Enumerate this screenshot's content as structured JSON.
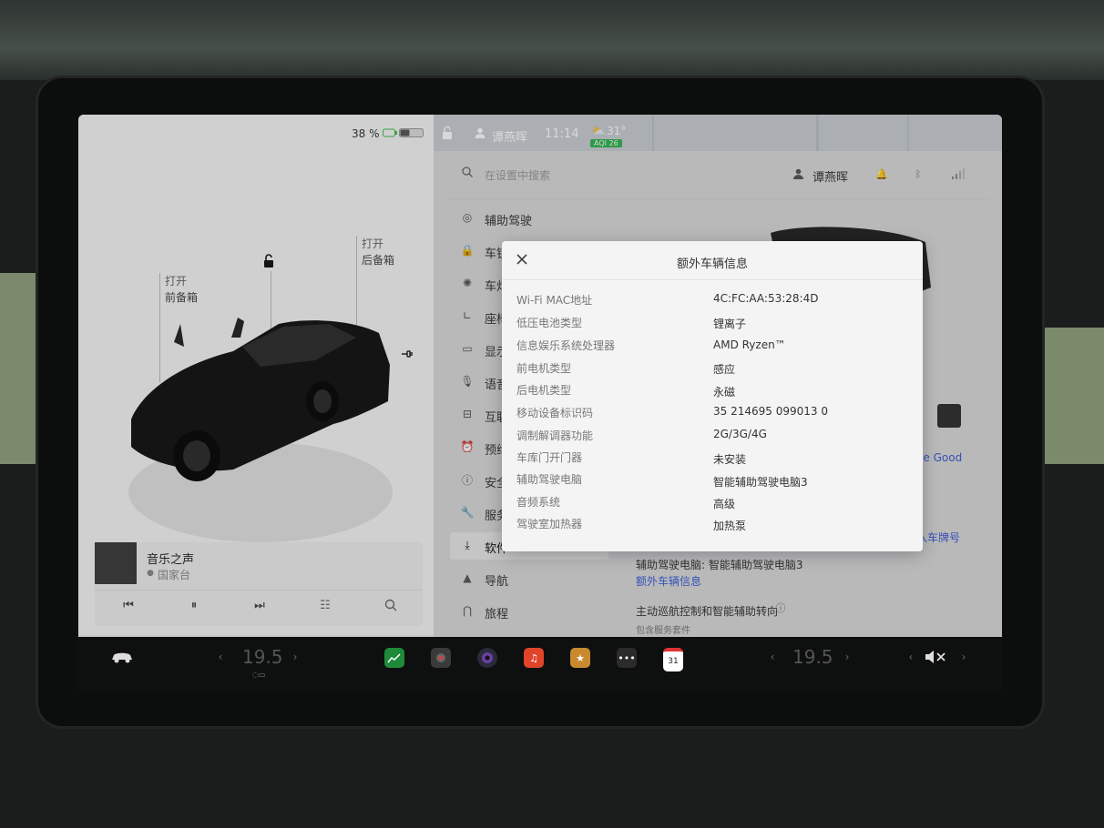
{
  "status": {
    "battery_percent": "38 %",
    "user_name": "谭燕晖",
    "time": "11:14",
    "temperature": "31°",
    "aqi": "AQI 26"
  },
  "car_panel": {
    "frunk_open_line1": "打开",
    "frunk_open_line2": "前备箱",
    "trunk_open_line1": "打开",
    "trunk_open_line2": "后备箱"
  },
  "media": {
    "title": "音乐之声",
    "source": "国家台"
  },
  "settings": {
    "search_placeholder": "在设置中搜索",
    "profile_name": "谭燕晖",
    "nav": [
      {
        "label": "辅助驾驶"
      },
      {
        "label": "车锁"
      },
      {
        "label": "车灯"
      },
      {
        "label": "座椅"
      },
      {
        "label": "显示"
      },
      {
        "label": "语音"
      },
      {
        "label": "互联"
      },
      {
        "label": "预约"
      },
      {
        "label": "安全"
      },
      {
        "label": "服务"
      },
      {
        "label": "软件"
      },
      {
        "label": "导航"
      },
      {
        "label": "旅程"
      }
    ],
    "right_snippet": "ee Good",
    "plate_link": "入车牌号",
    "autopilot_computer": "辅助驾驶电脑: 智能辅助驾驶电脑3",
    "extra_info_link": "额外车辆信息",
    "feature_title": "主动巡航控制和智能辅助转向",
    "feature_sub": "包含服务套件"
  },
  "modal": {
    "title": "额外车辆信息",
    "rows": [
      {
        "label": "Wi-Fi MAC地址",
        "value": "4C:FC:AA:53:28:4D"
      },
      {
        "label": "低压电池类型",
        "value": "锂离子"
      },
      {
        "label": "信息娱乐系统处理器",
        "value": "AMD Ryzen™"
      },
      {
        "label": "前电机类型",
        "value": "感应"
      },
      {
        "label": "后电机类型",
        "value": "永磁"
      },
      {
        "label": "移动设备标识码",
        "value": "35 214695 099013 0"
      },
      {
        "label": "调制解调器功能",
        "value": "2G/3G/4G"
      },
      {
        "label": "车库门开门器",
        "value": "未安装"
      },
      {
        "label": "辅助驾驶电脑",
        "value": "智能辅助驾驶电脑3"
      },
      {
        "label": "音频系统",
        "value": "高级"
      },
      {
        "label": "驾驶室加热器",
        "value": "加热泵"
      }
    ]
  },
  "bottom_bar": {
    "driver_temp": "19.5",
    "passenger_temp": "19.5",
    "calendar_day": "31"
  },
  "colors": {
    "accent_link": "#3b5bd6",
    "aqi_badge": "#2fb34f"
  }
}
